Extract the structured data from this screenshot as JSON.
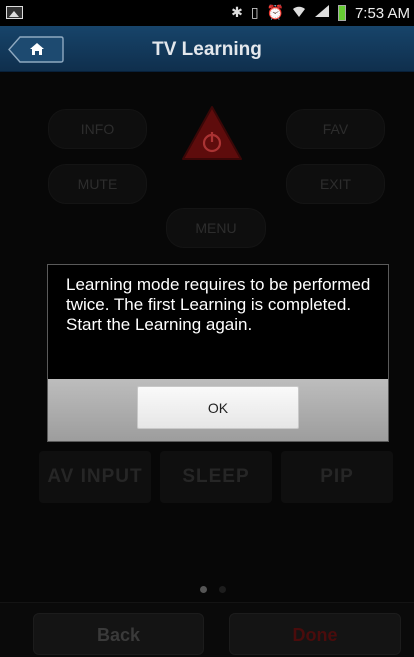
{
  "status_bar": {
    "time": "7:53 AM",
    "icons": [
      "gallery-icon",
      "bluetooth-icon",
      "vibrate-icon",
      "alarm-icon",
      "wifi-icon",
      "signal-icon",
      "battery-icon"
    ]
  },
  "header": {
    "title": "TV Learning",
    "home_icon": "home-icon"
  },
  "remote": {
    "buttons": {
      "info": "INFO",
      "fav": "FAV",
      "mute": "MUTE",
      "exit": "EXIT",
      "menu": "MENU",
      "av_input": "AV INPUT",
      "sleep": "SLEEP",
      "pip": "PIP"
    },
    "power_icon": "power-icon",
    "page_indicator": {
      "pages": 2,
      "current": 1
    }
  },
  "dialog": {
    "message": "Learning mode requires to be performed twice. The first Learning is completed. Start the Learning again.",
    "ok_label": "OK"
  },
  "footer": {
    "back_label": "Back",
    "done_label": "Done"
  },
  "colors": {
    "title_bar": "#17446a",
    "power_red": "#7a1111",
    "done_red": "#5a0f0f",
    "dialog_footer": "#a8a8a8"
  }
}
